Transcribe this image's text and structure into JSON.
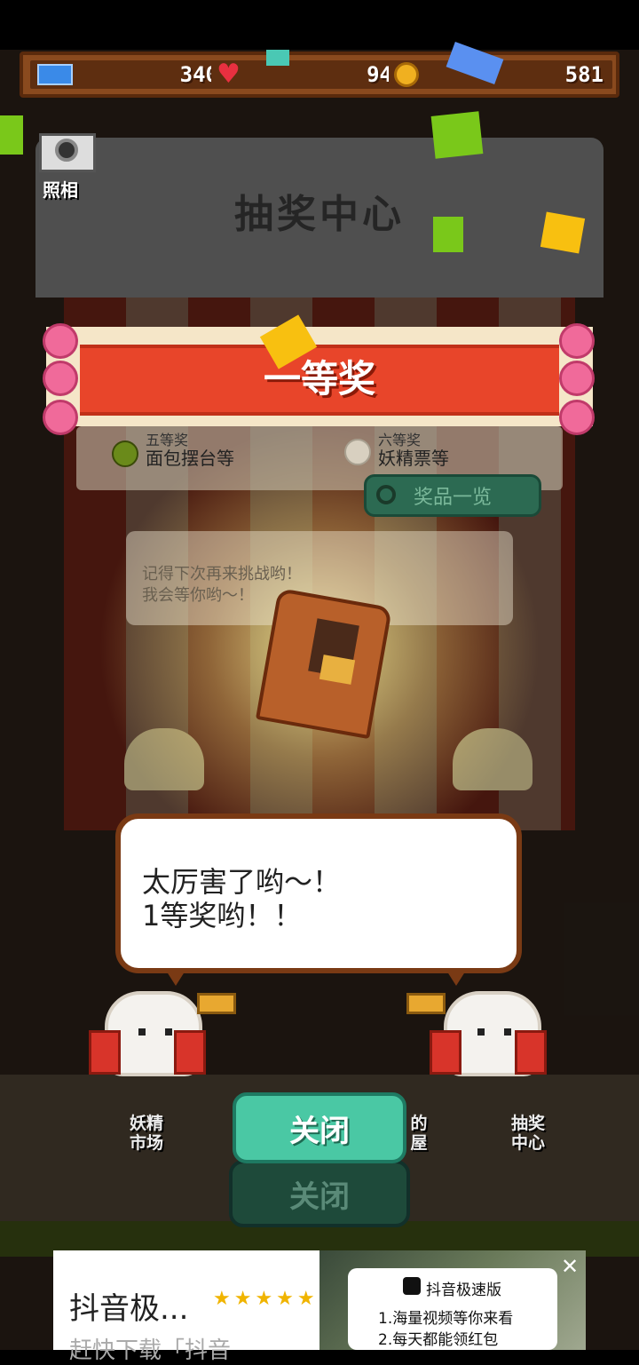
{
  "hud": {
    "tickets": "340",
    "hearts": "94",
    "coins": "581"
  },
  "camera": {
    "label": "照相"
  },
  "booth": {
    "title": "抽奖中心"
  },
  "banner": {
    "text": "一等奖"
  },
  "prizes": [
    {
      "rank": "五等奖",
      "name": "面包摆台等",
      "color": "#6a8a1a"
    },
    {
      "rank": "六等奖",
      "name": "妖精票等",
      "color": "#d8d0c0"
    }
  ],
  "prize_list_button": {
    "label": "奖品一览"
  },
  "faded_bubble": {
    "line1": "记得下次再来挑战哟！",
    "line2": "我会等你哟～！"
  },
  "dialogue": {
    "line1": "太厉害了哟～！",
    "line2": "1等奖哟！！"
  },
  "buildings": [
    {
      "line1": "妖精",
      "line2": "市场"
    },
    {
      "line1": "的",
      "line2": "屋"
    },
    {
      "line1": "抽奖",
      "line2": "中心"
    }
  ],
  "close_button": {
    "label": "关闭"
  },
  "close_button_shadow": {
    "label": "关闭"
  },
  "ad": {
    "title": "抖音极...",
    "subtitle": "赶快下载「抖音",
    "stars": "★★★★★",
    "brand": "抖音极速版",
    "line1": "1.海量视频等你来看",
    "line2": "2.每天都能领红包",
    "close": "✕"
  },
  "colors": {
    "accent_green": "#4ac8a4",
    "banner_red": "#e8452a",
    "hud_brown": "#8a4a1e"
  }
}
